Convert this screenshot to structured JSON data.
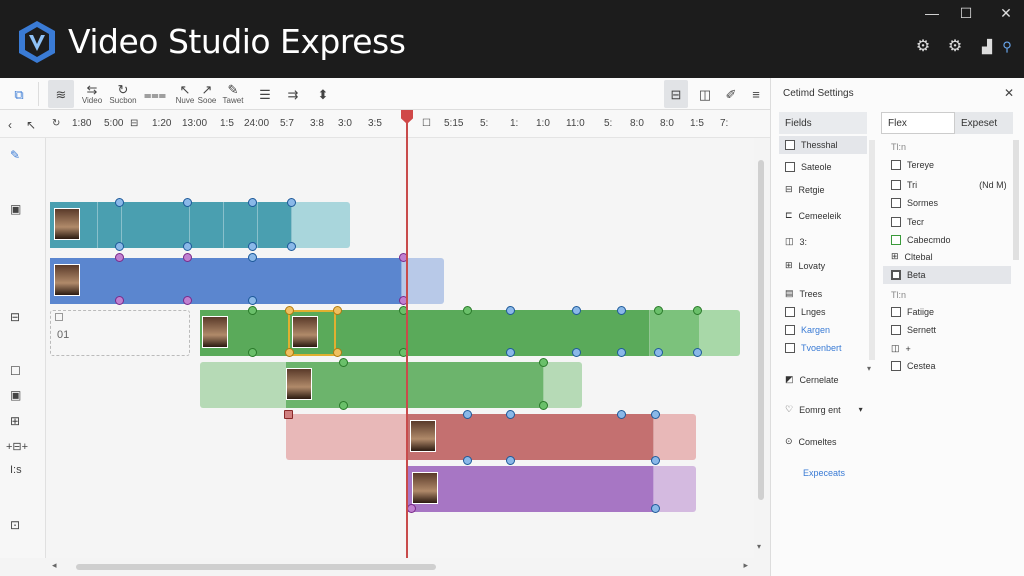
{
  "app": {
    "title": "Video Studio Express",
    "accent": "#3a7bd5"
  },
  "window_controls": [
    "—",
    "☐",
    "✕"
  ],
  "header_icons": [
    "gear-icon",
    "gear-icon",
    "chart-icon"
  ],
  "toolbar": {
    "buttons": [
      {
        "label": "",
        "icon": "≋"
      },
      {
        "label": "Video",
        "icon": "⇆"
      },
      {
        "label": "Sucbon",
        "icon": "↻"
      },
      {
        "label": "",
        "icon": "⩶"
      },
      {
        "label": "Nuve",
        "icon": "↖"
      },
      {
        "label": "Sooe",
        "icon": "↗"
      },
      {
        "label": "Tawet",
        "icon": "✎"
      },
      {
        "label": "",
        "icon": "☰"
      },
      {
        "label": "",
        "icon": "⇉"
      },
      {
        "label": "",
        "icon": "⬍"
      }
    ],
    "right_icons": [
      "⊟",
      "◫",
      "✐",
      "≡"
    ]
  },
  "ruler": {
    "ticks": [
      "1:80",
      "5:00",
      "1:20",
      "13:00",
      "1:5",
      "24:00",
      "5:7",
      "3:8",
      "3:0",
      "3:5",
      "5:15",
      "5:",
      "1:",
      "1:0",
      "11:0",
      "5:",
      "8:0",
      "8:0",
      "1:5",
      "7:"
    ]
  },
  "left_icons": [
    "✎",
    "▣",
    "⊟",
    "☐",
    "⊞",
    "+⊟+",
    "I:s",
    "⊡"
  ],
  "timeline": {
    "placeholder_label": "01"
  },
  "panel": {
    "title": "Cetimd Settings",
    "tabs": {
      "fields": "Fields",
      "flex": "Flex",
      "expeset": "Expeset"
    },
    "left_items": [
      "Thesshal",
      "Sateole",
      "Retgie",
      "Cemeeleik",
      "3:",
      "Lovaty",
      "Trees",
      "Lnges",
      "Kargen",
      "Tvoenbert",
      "Cernelate",
      "Eomrg ent",
      "Comeltes"
    ],
    "link": "Expeceats",
    "section1": "Tl:n",
    "right_items_a": [
      "Tereye",
      "Tri",
      "Sormes",
      "Tecr",
      "Cabecmdo",
      "Cltebal",
      "Beta"
    ],
    "right_value": "(Nd M)",
    "section2": "Tl:n",
    "right_items_b": [
      "Fatiige",
      "Sernett",
      "+",
      "Cestea"
    ]
  }
}
